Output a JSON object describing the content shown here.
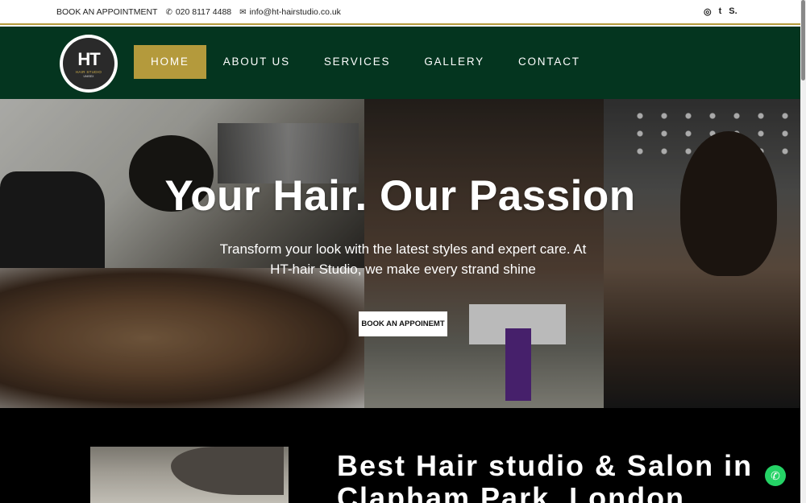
{
  "topbar": {
    "book_label": "BOOK AN APPOINTMENT",
    "phone": "020 8117 4488",
    "email": "info@ht-hairstudio.co.uk",
    "phone_icon": "phone-icon",
    "email_icon": "envelope-icon",
    "social": [
      {
        "icon": "instagram-icon",
        "glyph": "◎"
      },
      {
        "icon": "tumblr-icon",
        "glyph": "t"
      },
      {
        "icon": "squarespace-icon",
        "glyph": "S."
      }
    ]
  },
  "logo": {
    "initials": "HT",
    "line1": "HAIR STUDIO",
    "line2": "UNISEX"
  },
  "nav": {
    "items": [
      "HOME",
      "ABOUT US",
      "SERVICES",
      "GALLERY",
      "CONTACT"
    ],
    "active": "HOME"
  },
  "hero": {
    "title": "Your Hair. Our Passion",
    "tagline": "Transform your look with the latest styles and expert care. At HT-hair Studio, we make every strand shine",
    "cta_label": "BOOK AN APPOINEMT"
  },
  "about": {
    "heading": "Best Hair studio & Salon in Clapham Park, London"
  },
  "floating": {
    "whatsapp_icon": "whatsapp-icon"
  },
  "colors": {
    "nav_bg": "#04351f",
    "accent_gold": "#b49a3c",
    "about_bg": "#000000",
    "whatsapp_green": "#25d366"
  }
}
